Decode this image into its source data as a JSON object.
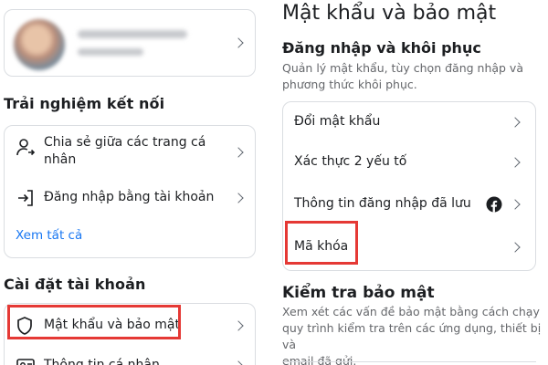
{
  "left": {
    "experience_title": "Trải nghiệm kết nối",
    "experience_items": [
      {
        "label": "Chia sẻ giữa các trang cá nhân",
        "icon": "person-share-icon"
      },
      {
        "label": "Đăng nhập bằng tài khoản",
        "icon": "login-arrow-icon"
      }
    ],
    "see_all": "Xem tất cả",
    "account_title": "Cài đặt tài khoản",
    "account_items": [
      {
        "label": "Mật khẩu và bảo mật",
        "icon": "shield-icon"
      },
      {
        "label": "Thông tin cá nhân",
        "icon": "id-card-icon"
      }
    ]
  },
  "right": {
    "title": "Mật khẩu và bảo mật",
    "login_section": {
      "title": "Đăng nhập và khôi phục",
      "description_line1": "Quản lý mật khẩu, tùy chọn đăng nhập và",
      "description_line2": "phương thức khôi phục.",
      "items": [
        {
          "label": "Đổi mật khẩu"
        },
        {
          "label": "Xác thực 2 yếu tố"
        },
        {
          "label": "Thông tin đăng nhập đã lưu",
          "icon": "facebook-icon"
        },
        {
          "label": "Mã khóa"
        }
      ]
    },
    "security_check": {
      "title": "Kiểm tra bảo mật",
      "description_line1": "Xem xét các vấn đề bảo mật bằng cách chạy",
      "description_line2": "quy trình kiểm tra trên các ứng dụng, thiết bị và",
      "description_line3": "email đã gửi."
    }
  },
  "colors": {
    "accent_link": "#1877f2",
    "highlight": "#e53935",
    "facebook_blue": "#1877f2"
  }
}
